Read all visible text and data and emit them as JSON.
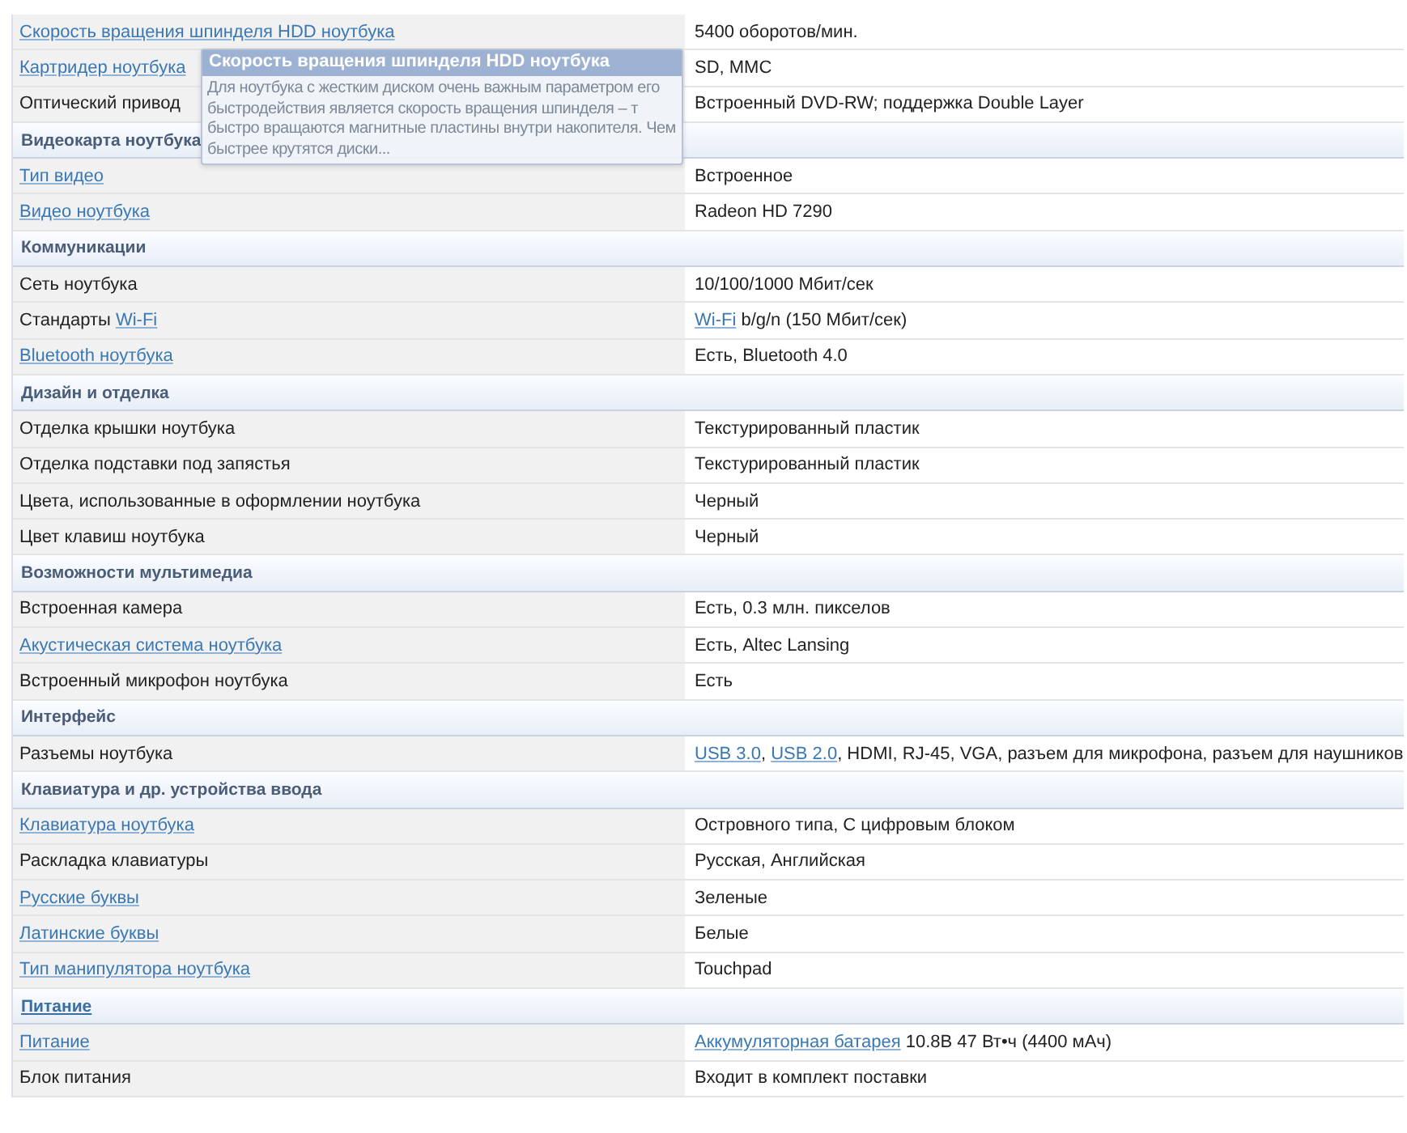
{
  "rows": [
    {
      "kind": "row",
      "label": [
        {
          "text": "Скорость вращения шпинделя HDD ноутбука",
          "link": true
        }
      ],
      "value": [
        {
          "text": "5400 оборотов/мин.",
          "link": false
        }
      ]
    },
    {
      "kind": "row",
      "label": [
        {
          "text": "Картридер ноутбука",
          "link": true
        }
      ],
      "value": [
        {
          "text": "SD, MMC",
          "link": false
        }
      ]
    },
    {
      "kind": "row",
      "label": [
        {
          "text": "Оптический привод",
          "link": false
        }
      ],
      "value": [
        {
          "text": "Встроенный DVD-RW; поддержка Double Layer",
          "link": false
        }
      ]
    },
    {
      "kind": "section",
      "title": "Видеокарта ноутбука",
      "link": false
    },
    {
      "kind": "row",
      "label": [
        {
          "text": "Тип видео",
          "link": true
        }
      ],
      "value": [
        {
          "text": "Встроенное",
          "link": false
        }
      ]
    },
    {
      "kind": "row",
      "label": [
        {
          "text": "Видео ноутбука",
          "link": true
        }
      ],
      "value": [
        {
          "text": "Radeon HD 7290",
          "link": false
        }
      ]
    },
    {
      "kind": "section",
      "title": "Коммуникации",
      "link": false
    },
    {
      "kind": "row",
      "label": [
        {
          "text": "Сеть ноутбука",
          "link": false
        }
      ],
      "value": [
        {
          "text": "10/100/1000 Мбит/сек",
          "link": false
        }
      ]
    },
    {
      "kind": "row",
      "label": [
        {
          "text": "Стандарты ",
          "link": false
        },
        {
          "text": "Wi-Fi",
          "link": true
        }
      ],
      "value": [
        {
          "text": "Wi-Fi",
          "link": true
        },
        {
          "text": " b/g/n (150 Мбит/сек)",
          "link": false
        }
      ]
    },
    {
      "kind": "row",
      "label": [
        {
          "text": "Bluetooth ноутбука",
          "link": true
        }
      ],
      "value": [
        {
          "text": "Есть, Bluetooth 4.0",
          "link": false
        }
      ]
    },
    {
      "kind": "section",
      "title": "Дизайн и отделка",
      "link": false
    },
    {
      "kind": "row",
      "label": [
        {
          "text": "Отделка крышки ноутбука",
          "link": false
        }
      ],
      "value": [
        {
          "text": "Текстурированный пластик",
          "link": false
        }
      ]
    },
    {
      "kind": "row",
      "label": [
        {
          "text": "Отделка подставки под запястья",
          "link": false
        }
      ],
      "value": [
        {
          "text": "Текстурированный пластик",
          "link": false
        }
      ]
    },
    {
      "kind": "row",
      "label": [
        {
          "text": "Цвета, использованные в оформлении ноутбука",
          "link": false
        }
      ],
      "value": [
        {
          "text": "Черный",
          "link": false
        }
      ]
    },
    {
      "kind": "row",
      "label": [
        {
          "text": "Цвет клавиш ноутбука",
          "link": false
        }
      ],
      "value": [
        {
          "text": "Черный",
          "link": false
        }
      ]
    },
    {
      "kind": "section",
      "title": "Возможности мультимедиа",
      "link": false
    },
    {
      "kind": "row",
      "label": [
        {
          "text": "Встроенная камера",
          "link": false
        }
      ],
      "value": [
        {
          "text": "Есть, 0.3 млн. пикселов",
          "link": false
        }
      ]
    },
    {
      "kind": "row",
      "label": [
        {
          "text": "Акустическая система ноутбука",
          "link": true
        }
      ],
      "value": [
        {
          "text": "Есть, Altec Lansing",
          "link": false
        }
      ]
    },
    {
      "kind": "row",
      "label": [
        {
          "text": "Встроенный микрофон ноутбука",
          "link": false
        }
      ],
      "value": [
        {
          "text": "Есть",
          "link": false
        }
      ]
    },
    {
      "kind": "section",
      "title": "Интерфейс",
      "link": false
    },
    {
      "kind": "row",
      "label": [
        {
          "text": "Разъемы ноутбука",
          "link": false
        }
      ],
      "value": [
        {
          "text": "USB 3.0",
          "link": true
        },
        {
          "text": ", ",
          "link": false
        },
        {
          "text": "USB 2.0",
          "link": true
        },
        {
          "text": ", HDMI, RJ-45, VGA, разъем для микрофона, разъем для наушников",
          "link": false
        }
      ]
    },
    {
      "kind": "section",
      "title": "Клавиатура и др. устройства ввода",
      "link": false
    },
    {
      "kind": "row",
      "label": [
        {
          "text": "Клавиатура ноутбука",
          "link": true
        }
      ],
      "value": [
        {
          "text": "Островного типа, С цифровым блоком",
          "link": false
        }
      ]
    },
    {
      "kind": "row",
      "label": [
        {
          "text": "Раскладка клавиатуры",
          "link": false
        }
      ],
      "value": [
        {
          "text": "Русская, Английская",
          "link": false
        }
      ]
    },
    {
      "kind": "row",
      "label": [
        {
          "text": "Русские буквы",
          "link": true
        }
      ],
      "value": [
        {
          "text": "Зеленые",
          "link": false
        }
      ]
    },
    {
      "kind": "row",
      "label": [
        {
          "text": "Латинские буквы",
          "link": true
        }
      ],
      "value": [
        {
          "text": "Белые",
          "link": false
        }
      ]
    },
    {
      "kind": "row",
      "label": [
        {
          "text": "Тип манипулятора ноутбука",
          "link": true
        }
      ],
      "value": [
        {
          "text": "Touchpad",
          "link": false
        }
      ]
    },
    {
      "kind": "section",
      "title": "Питание",
      "link": true
    },
    {
      "kind": "row",
      "label": [
        {
          "text": "Питание",
          "link": true
        }
      ],
      "value": [
        {
          "text": "Аккумуляторная батарея",
          "link": true
        },
        {
          "text": " 10.8В 47 Вт•ч (4400 мАч)",
          "link": false
        }
      ]
    },
    {
      "kind": "row",
      "label": [
        {
          "text": "Блок питания",
          "link": false
        }
      ],
      "value": [
        {
          "text": "Входит в комплект поставки",
          "link": false
        }
      ]
    }
  ],
  "tooltip": {
    "title": "Скорость вращения шпинделя HDD ноутбука",
    "lines": [
      "Для ноутбука с жестким диском очень важным параметром его",
      "быстродействия является скорость вращения шпинделя – т",
      "быстро вращаются магнитные пластины внутри накопителя. Чем",
      "быстрее крутятся диски..."
    ]
  }
}
